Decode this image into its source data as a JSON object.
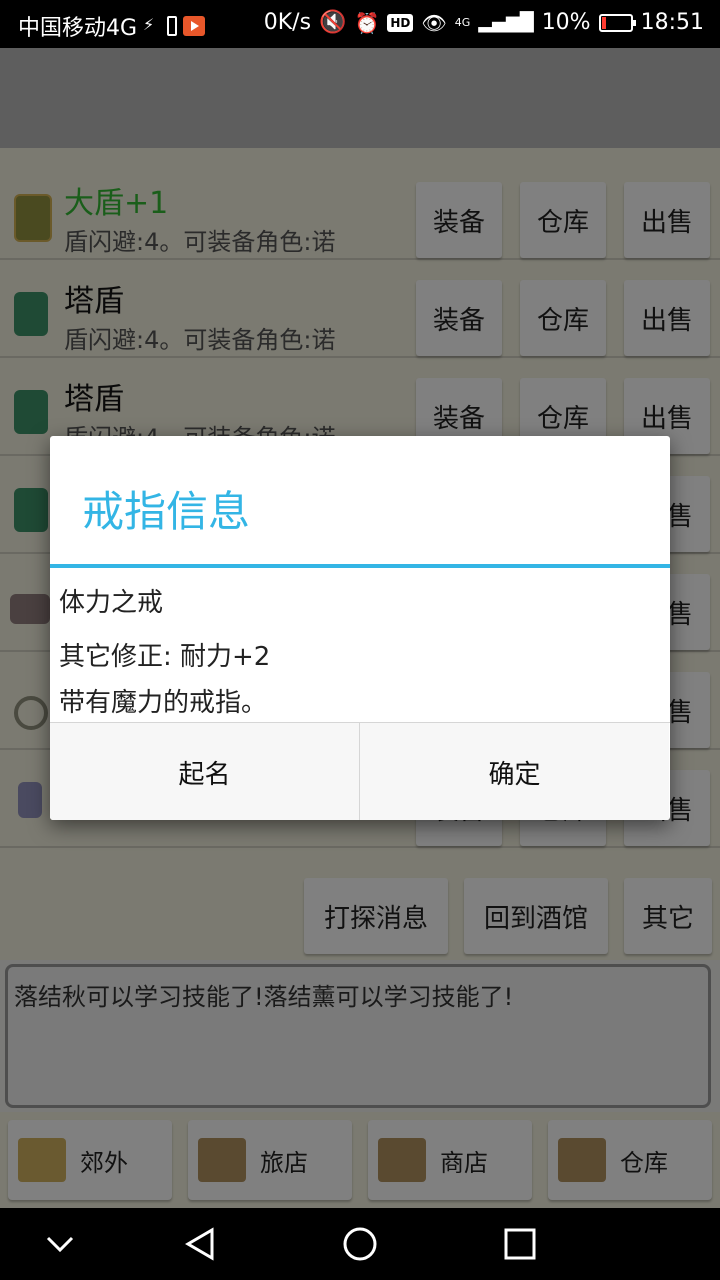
{
  "status_bar": {
    "carrier": "中国移动4G",
    "net_speed": "0K/s",
    "network_type": "4G",
    "battery": "10%",
    "time": "18:51"
  },
  "items": [
    {
      "name": "大盾+1",
      "desc": "盾闪避:4。可装备角色:诺",
      "color": "#1a5e1a"
    },
    {
      "name": "塔盾",
      "desc": "盾闪避:4。可装备角色:诺"
    },
    {
      "name": "塔盾",
      "desc": "盾闪避:4。可装备角色:诺"
    }
  ],
  "row_buttons": {
    "equip": "装备",
    "warehouse": "仓库",
    "sell": "出售"
  },
  "actions": {
    "scout": "打探消息",
    "return_tavern": "回到酒馆",
    "other": "其它"
  },
  "message_log": "落结秋可以学习技能了!落结薰可以学习技能了!",
  "bottom_nav": [
    {
      "label": "郊外",
      "icon": "signpost-icon"
    },
    {
      "label": "旅店",
      "icon": "inn-sign-icon"
    },
    {
      "label": "商店",
      "icon": "shop-sign-icon"
    },
    {
      "label": "仓库",
      "icon": "warehouse-sign-icon"
    }
  ],
  "dialog": {
    "title": "戒指信息",
    "item_name": "体力之戒",
    "modifier": "其它修正: 耐力+2",
    "description": "带有魔力的戒指。",
    "name_button": "起名",
    "ok_button": "确定"
  },
  "colors": {
    "accent": "#33b5e5",
    "dim_background": "#7b7a71"
  }
}
